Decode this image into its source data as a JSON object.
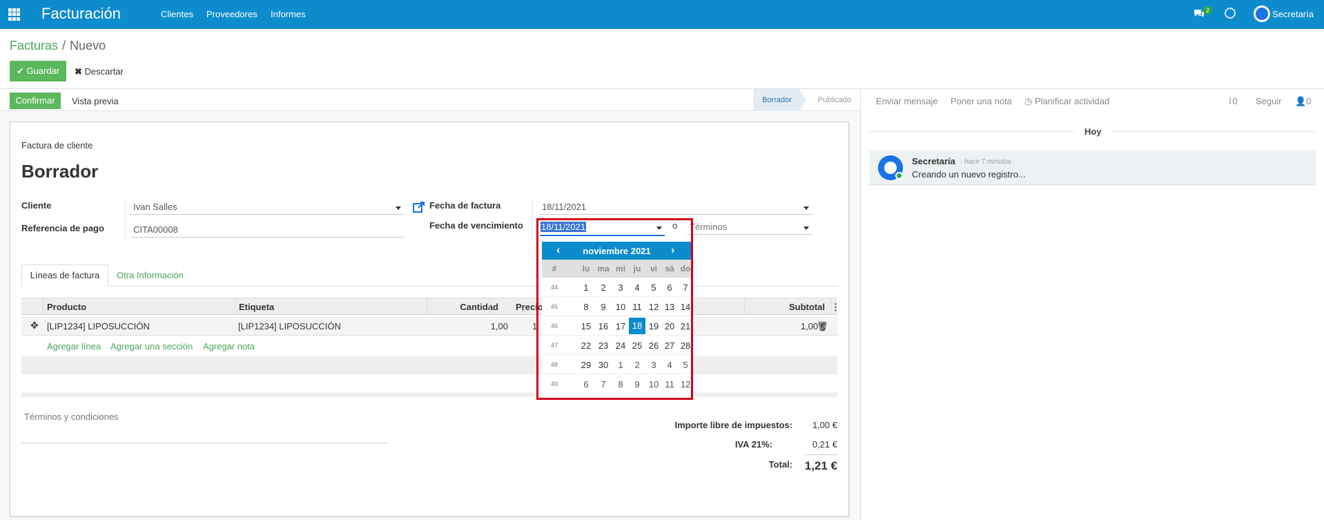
{
  "navbar": {
    "brand": "Facturación",
    "menu": [
      "Clientes",
      "Proveedores",
      "Informes"
    ],
    "chat_count": "2",
    "user_name": "Secretaría"
  },
  "breadcrumb": {
    "parent": "Facturas",
    "separator": "/",
    "current": "Nuevo"
  },
  "toolbar": {
    "save": "Guardar",
    "discard": "Descartar"
  },
  "statusbar": {
    "confirm": "Confirmar",
    "preview": "Vista previa",
    "stages": [
      "Borrador",
      "Publicado"
    ]
  },
  "form": {
    "doc_type": "Factura de cliente",
    "title": "Borrador",
    "customer_label": "Cliente",
    "customer_value": "Ivan Salles",
    "payment_ref_label": "Referencia de pago",
    "payment_ref_value": "CITA00008",
    "invoice_date_label": "Fecha de factura",
    "invoice_date_value": "18/11/2021",
    "due_date_label": "Fecha de vencimiento",
    "due_date_value": "18/11/2021",
    "due_date_or": "o",
    "terms_placeholder": "Términos"
  },
  "tabs": [
    "Líneas de factura",
    "Otra Información"
  ],
  "table": {
    "headers": [
      "Producto",
      "Etiqueta",
      "Cantidad",
      "Precio",
      "Subtotal"
    ],
    "rows": [
      {
        "product": "[LIP1234] LIPOSUCCIÓN",
        "label": "[LIP1234] LIPOSUCCIÓN",
        "quantity": "1,00",
        "price": "1",
        "subtotal": "1,00 €"
      }
    ],
    "add_line": "Agregar línea",
    "add_section": "Agregar una sección",
    "add_note": "Agregar nota"
  },
  "terms": "Términos y condiciones",
  "totals": {
    "untaxed_label": "Importe libre de impuestos:",
    "untaxed_value": "1,00 €",
    "tax_label": "IVA 21%:",
    "tax_value": "0,21 €",
    "total_label": "Total:",
    "total_value": "1,21 €"
  },
  "chatter": {
    "send_message": "Enviar mensaje",
    "log_note": "Poner una nota",
    "schedule_activity": "Planificar actividad",
    "attachments": "0",
    "follow": "Seguir",
    "followers": "0",
    "today": "Hoy",
    "message": {
      "author": "Secretaría",
      "time": "- hace 7 minutos",
      "body": "Creando un nuevo registro..."
    }
  },
  "datepicker": {
    "title": "noviembre 2021",
    "week_header": "#",
    "days": [
      "lu",
      "ma",
      "mi",
      "ju",
      "vi",
      "sá",
      "do"
    ],
    "selected": "18",
    "weeks": [
      {
        "week": "44",
        "days": [
          "1",
          "2",
          "3",
          "4",
          "5",
          "6",
          "7"
        ]
      },
      {
        "week": "45",
        "days": [
          "8",
          "9",
          "10",
          "11",
          "12",
          "13",
          "14"
        ]
      },
      {
        "week": "46",
        "days": [
          "15",
          "16",
          "17",
          "18",
          "19",
          "20",
          "21"
        ]
      },
      {
        "week": "47",
        "days": [
          "22",
          "23",
          "24",
          "25",
          "26",
          "27",
          "28"
        ]
      },
      {
        "week": "48",
        "days": [
          "29",
          "30",
          "1",
          "2",
          "3",
          "4",
          "5"
        ]
      },
      {
        "week": "49",
        "days": [
          "6",
          "7",
          "8",
          "9",
          "10",
          "11",
          "12"
        ]
      }
    ]
  }
}
